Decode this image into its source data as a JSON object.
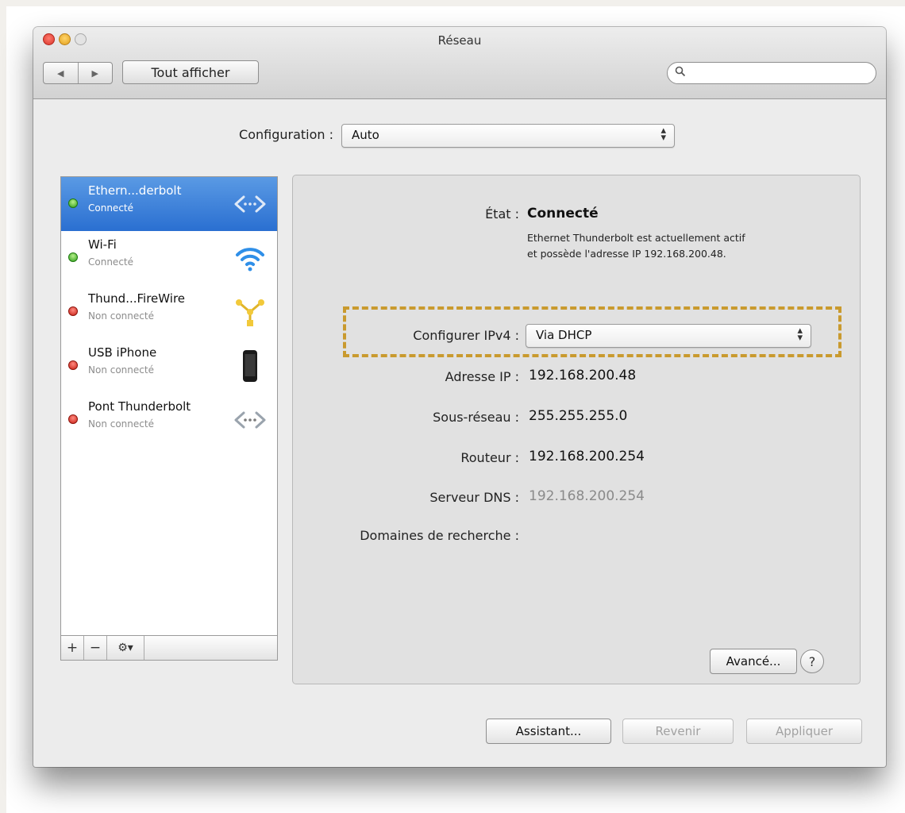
{
  "window": {
    "title": "Réseau",
    "show_all_label": "Tout afficher",
    "search_placeholder": ""
  },
  "configuration": {
    "label": "Configuration :",
    "value": "Auto"
  },
  "services": [
    {
      "name": "Ethern...derbolt",
      "status": "Connecté",
      "state": "green",
      "icon": "ethernet-arrows-icon",
      "selected": true
    },
    {
      "name": "Wi-Fi",
      "status": "Connecté",
      "state": "green",
      "icon": "wifi-icon",
      "selected": false
    },
    {
      "name": "Thund...FireWire",
      "status": "Non connecté",
      "state": "red",
      "icon": "firewire-icon",
      "selected": false
    },
    {
      "name": "USB iPhone",
      "status": "Non connecté",
      "state": "red",
      "icon": "iphone-icon",
      "selected": false
    },
    {
      "name": "Pont Thunderbolt",
      "status": "Non connecté",
      "state": "red",
      "icon": "bridge-arrows-icon",
      "selected": false
    }
  ],
  "toolbar": {
    "add": "+",
    "remove": "−",
    "gear": "⚙▾"
  },
  "detail": {
    "state_label": "État :",
    "state_value": "Connecté",
    "state_desc_line1": "Ethernet Thunderbolt est actuellement actif",
    "state_desc_line2": "et possède l'adresse IP 192.168.200.48.",
    "ipv4_label": "Configurer IPv4 :",
    "ipv4_value": "Via DHCP",
    "ip_label": "Adresse IP :",
    "ip_value": "192.168.200.48",
    "subnet_label": "Sous-réseau :",
    "subnet_value": "255.255.255.0",
    "router_label": "Routeur :",
    "router_value": "192.168.200.254",
    "dns_label": "Serveur DNS :",
    "dns_value": "192.168.200.254",
    "domains_label": "Domaines de recherche :",
    "advanced_label": "Avancé...",
    "help_label": "?"
  },
  "footer": {
    "assistant_label": "Assistant...",
    "revert_label": "Revenir",
    "apply_label": "Appliquer"
  },
  "colors": {
    "selection": "#2a6fd1",
    "highlight_border": "#c99a2e",
    "connected": "#2e9e1a",
    "disconnected": "#c81f14"
  }
}
